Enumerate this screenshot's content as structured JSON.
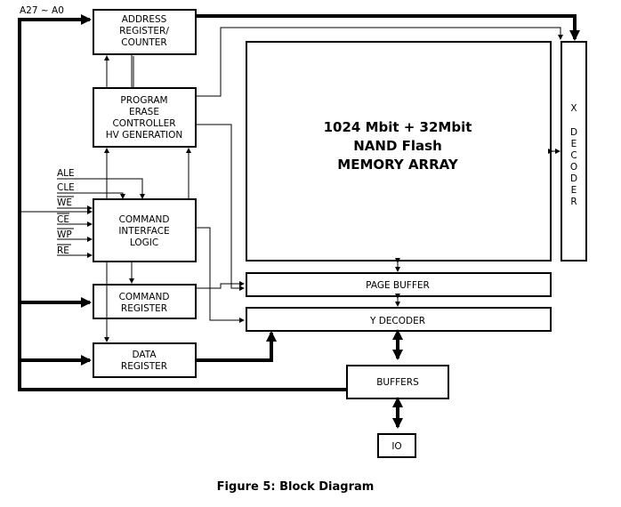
{
  "caption": "Figure 5: Block Diagram",
  "address_bus_label": "A27 ~ A0",
  "control_signals": [
    {
      "name": "ALE",
      "active_low": false
    },
    {
      "name": "CLE",
      "active_low": false
    },
    {
      "name": "WE",
      "active_low": true
    },
    {
      "name": "CE",
      "active_low": true
    },
    {
      "name": "WP",
      "active_low": true
    },
    {
      "name": "RE",
      "active_low": true
    }
  ],
  "blocks": {
    "address_register": [
      "ADDRESS",
      "REGISTER/",
      "COUNTER"
    ],
    "program_erase": [
      "PROGRAM",
      "ERASE",
      "CONTROLLER",
      "HV GENERATION"
    ],
    "command_interface": [
      "COMMAND",
      "INTERFACE",
      "LOGIC"
    ],
    "command_register": [
      "COMMAND",
      "REGISTER"
    ],
    "data_register": [
      "DATA",
      "REGISTER"
    ],
    "memory_array": [
      "1024 Mbit + 32Mbit",
      "NAND Flash",
      "MEMORY ARRAY"
    ],
    "x_decoder": [
      "X",
      "D",
      "E",
      "C",
      "O",
      "D",
      "E",
      "R"
    ],
    "page_buffer": "PAGE BUFFER",
    "y_decoder": "Y DECODER",
    "buffers": "BUFFERS",
    "io": "IO"
  }
}
